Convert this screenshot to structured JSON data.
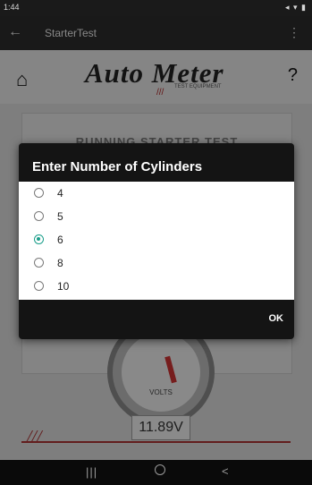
{
  "status_bar": {
    "time": "1:44",
    "right": "◂ ▾ ▮"
  },
  "app_bar": {
    "back_icon": "←",
    "title": "StarterTest",
    "menu_icon": "⋮"
  },
  "header": {
    "home_icon": "⌂",
    "logo_text": "Auto Meter",
    "logo_sub": "TEST EQUIPMENT",
    "help_icon": "?"
  },
  "screen": {
    "running_text": "RUNNING STARTER TEST",
    "readout": "11.89V",
    "gauge_label": "VOLTS"
  },
  "dialog": {
    "title": "Enter Number of Cylinders",
    "options": [
      "4",
      "5",
      "6",
      "8",
      "10"
    ],
    "selected": "6",
    "ok_label": "OK",
    "accent": "#1a9e8a"
  },
  "nav_bar": {
    "recent_icon": "|||",
    "home_icon": "○",
    "back_icon": "<"
  }
}
